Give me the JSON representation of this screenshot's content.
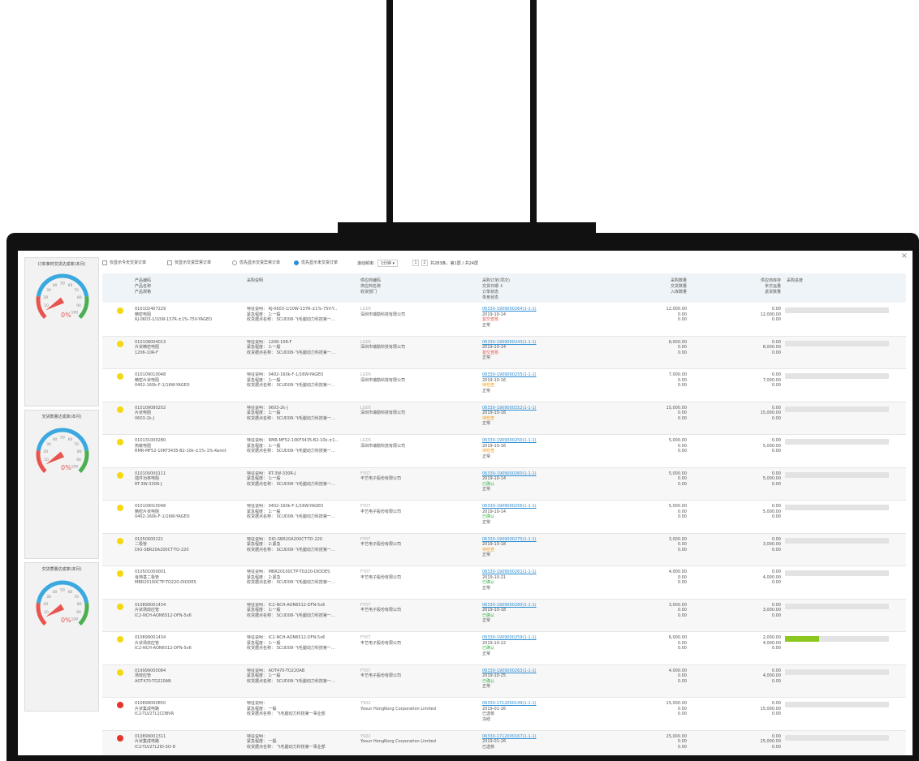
{
  "header": {
    "filters": {
      "only_today": "仅显示今天交货订单",
      "only_abnormal": "仅显示交货异常订单",
      "prio_abnormal": "优先显示交货异常订单",
      "prio_undelivered": "优先显示未交货订单"
    },
    "refresh_label": "滚动频率:",
    "refresh_value": "1分钟",
    "pager_pages": [
      "1",
      "2"
    ],
    "pager_info": "共283条，第1屏 / 共24屏"
  },
  "gauges": [
    {
      "title": "订单准时交货达成率(本月)",
      "value": 0,
      "value_text": "0%"
    },
    {
      "title": "交货数量达成率(本月)",
      "value": 0,
      "value_text": "0%"
    },
    {
      "title": "交货质量达成率(本月)",
      "value": 0,
      "value_text": "0%"
    }
  ],
  "gauge_ticks": [
    "10",
    "20",
    "30",
    "40",
    "50",
    "60",
    "70",
    "80",
    "90",
    "100"
  ],
  "columns": {
    "product": [
      "产品编码",
      "产品名称",
      "产品规格"
    ],
    "purchase": "采购说明",
    "supplier": [
      "供应商编码",
      "供应商名称",
      "收货部门"
    ],
    "order": [
      "采购订单(项次)",
      "交货日期 ⇕",
      "订单状态",
      "单身状态"
    ],
    "qty": [
      "采购数量",
      "交货数量",
      "入库数量"
    ],
    "stock": [
      "供应商库存",
      "未交运量",
      "退货数量"
    ],
    "progress": "采购进度"
  },
  "colors": {
    "yellow": "#f5d80f",
    "red": "#e8322c",
    "accent": "#2a8dd4",
    "progress": "#8bc71e"
  },
  "rows": [
    {
      "status": "yellow",
      "code": "010102407229",
      "name": "精密电阻",
      "spec": "RJ-0603-1/10W-137R-±1%-75V-YAGEO",
      "p1": "特征说明： RJ-0603-1/10W-137R-±1%-75V-Y...",
      "p2": "紧急程度： 1:一般",
      "p3": "收货据点名称： SCUD08-飞毛腿动力科技第一...",
      "sup_code": "LG05",
      "sup_name": "深圳市瑞勒科技有限公司",
      "dept": "",
      "order": "06330-1909000264(1-1-1)",
      "date": "2019-10-14",
      "ostatus": "首交查核",
      "ostatus_cls": "red",
      "lstatus": "正常",
      "qty1": "12,000.00",
      "qty2": "0.00",
      "qty3": "0.00",
      "s1": "0.00",
      "s2": "12,000.00",
      "s3": "0.00",
      "progress": 0
    },
    {
      "status": "yellow",
      "code": "010108004013",
      "name": "片状精密电阻",
      "spec": "1206-10R-F",
      "p1": "特征说明： 1206-10R-F",
      "p2": "紧急程度： 1:一般",
      "p3": "收货据点名称： SCUD08-飞毛腿动力科技第一...",
      "sup_code": "LG05",
      "sup_name": "深圳市瑞勒科技有限公司",
      "dept": "",
      "order": "06330-1909000243(1-1-1)",
      "date": "2019-10-14",
      "ostatus": "首交查核",
      "ostatus_cls": "red",
      "lstatus": "正常",
      "qty1": "8,000.00",
      "qty2": "0.00",
      "qty3": "0.00",
      "s1": "0.00",
      "s2": "8,000.00",
      "s3": "0.00",
      "progress": 0
    },
    {
      "status": "yellow",
      "code": "010109010048",
      "name": "精密片状电阻",
      "spec": "0402-160k-F-1/16W-YAGEO",
      "p1": "特征说明： 0402-160k-F-1/16W-YAGEO",
      "p2": "紧急程度： 1:一般",
      "p3": "收货据点名称： SCUD08-飞毛腿动力科技第一...",
      "sup_code": "LG05",
      "sup_name": "深圳市瑞勒科技有限公司",
      "dept": "",
      "order": "06330-1909000255(1-1-1)",
      "date": "2019-10-16",
      "ostatus": "待检查",
      "ostatus_cls": "orange",
      "lstatus": "正常",
      "qty1": "7,000.00",
      "qty2": "0.00",
      "qty3": "0.00",
      "s1": "0.00",
      "s2": "7,000.00",
      "s3": "0.00",
      "progress": 0
    },
    {
      "status": "yellow",
      "code": "010109080202",
      "name": "片状电阻",
      "spec": "0603-2k-J",
      "p1": "特征说明： 0603-2k-J",
      "p2": "紧急程度： 1:一般",
      "p3": "收货据点名称： SCUD08-飞毛腿动力科技第一...",
      "sup_code": "LG05",
      "sup_name": "深圳市瑞勒科技有限公司",
      "dept": "",
      "order": "06330-1909000252(1-1-1)",
      "date": "2019-10-16",
      "ostatus": "待检查",
      "ostatus_cls": "orange",
      "lstatus": "正常",
      "qty1": "15,000.00",
      "qty2": "0.00",
      "qty3": "0.00",
      "s1": "0.00",
      "s2": "15,000.00",
      "s3": "0.00",
      "progress": 0
    },
    {
      "status": "yellow",
      "code": "010131000280",
      "name": "热敏电阻",
      "spec": "RMR-MF52-10KF3435-B2-10k-±1%-1%-Kemit",
      "p1": "特征说明： RMR-MF52-10KF3435-B2-10k-±1...",
      "p2": "紧急程度： 1:一般",
      "p3": "收货据点名称： SCUD08-飞毛腿动力科技第一...",
      "sup_code": "LG05",
      "sup_name": "深圳市瑞勒科技有限公司",
      "dept": "",
      "order": "06330-1909000250(1-1-1)",
      "date": "2019-10-16",
      "ostatus": "待检查",
      "ostatus_cls": "orange",
      "lstatus": "正常",
      "qty1": "5,000.00",
      "qty2": "0.00",
      "qty3": "0.00",
      "s1": "0.00",
      "s2": "5,000.00",
      "s3": "0.00",
      "progress": 0
    },
    {
      "status": "yellow",
      "code": "010100000111",
      "name": "插件功率电阻",
      "spec": "RT-3W-330R-J",
      "p1": "特征说明： RT-3W-330R-J",
      "p2": "紧急程度： 1:一般",
      "p3": "收货据点名称： SCUD08-飞毛腿动力科技第一...",
      "sup_code": "FY07",
      "sup_name": "丰艺电子股份有限公司",
      "dept": "",
      "order": "06330-1909000260(1-1-1)",
      "date": "2019-10-14",
      "ostatus": "已确认",
      "ostatus_cls": "green",
      "lstatus": "正常",
      "qty1": "5,000.00",
      "qty2": "0.00",
      "qty3": "0.00",
      "s1": "0.00",
      "s2": "5,000.00",
      "s3": "0.00",
      "progress": 0
    },
    {
      "status": "yellow",
      "code": "010109010048",
      "name": "精密片状电阻",
      "spec": "0402-160k-F-1/16W-YAGEO",
      "p1": "特征说明： 0402-160k-F-1/16W-YAGEO",
      "p2": "紧急程度： 1:一般",
      "p3": "收货据点名称： SCUD08-飞毛腿动力科技第一...",
      "sup_code": "FY07",
      "sup_name": "丰艺电子股份有限公司",
      "dept": "",
      "order": "06330-1909000256(1-1-1)",
      "date": "2019-10-14",
      "ostatus": "已确认",
      "ostatus_cls": "green",
      "lstatus": "正常",
      "qty1": "5,000.00",
      "qty2": "0.00",
      "qty3": "0.00",
      "s1": "0.00",
      "s2": "5,000.00",
      "s3": "0.00",
      "progress": 0
    },
    {
      "status": "yellow",
      "code": "01050000121",
      "name": "二极管",
      "spec": "DIO-SBR20A200CT-TO-220",
      "p1": "特征说明： DIO-SBR20A200CT-TO-220",
      "p2": "紧急程度： 2:紧急",
      "p3": "收货据点名称： SCUD08-飞毛腿动力科技第一...",
      "sup_code": "FY07",
      "sup_name": "丰艺电子股份有限公司",
      "dept": "",
      "order": "06330-1909000270(1-1-1)",
      "date": "2019-10-18",
      "ostatus": "待检查",
      "ostatus_cls": "orange",
      "lstatus": "正常",
      "qty1": "3,000.00",
      "qty2": "0.00",
      "qty3": "0.00",
      "s1": "0.00",
      "s2": "3,000.00",
      "s3": "0.00",
      "progress": 0
    },
    {
      "status": "yellow",
      "code": "010501000001",
      "name": "肖特基二极管",
      "spec": "MBR20100CTP-TO220-DIODES",
      "p1": "特征说明： MBR20100CTP-TO220-DIODES",
      "p2": "紧急程度： 2:紧急",
      "p3": "收货据点名称： SCUD08-飞毛腿动力科技第一...",
      "sup_code": "FY07",
      "sup_name": "丰艺电子股份有限公司",
      "dept": "",
      "order": "06330-1909000261(1-1-1)",
      "date": "2019-10-21",
      "ostatus": "已确认",
      "ostatus_cls": "green",
      "lstatus": "正常",
      "qty1": "4,000.00",
      "qty2": "0.00",
      "qty3": "0.00",
      "s1": "0.00",
      "s2": "4,000.00",
      "s3": "0.00",
      "progress": 0
    },
    {
      "status": "yellow",
      "code": "010899001434",
      "name": "片状场效应管",
      "spec": "IC2-NCH-AON6512-DFN-5x6",
      "p1": "特征说明： IC2-NCH-AON6512-DFN-5x6",
      "p2": "紧急程度： 1:一般",
      "p3": "收货据点名称： SCUD08-飞毛腿动力科技第一...",
      "sup_code": "FY07",
      "sup_name": "丰艺电子股份有限公司",
      "dept": "",
      "order": "06330-1909000280(1-1-1)",
      "date": "2019-10-18",
      "ostatus": "已确认",
      "ostatus_cls": "green",
      "lstatus": "正常",
      "qty1": "3,000.00",
      "qty2": "0.00",
      "qty3": "0.00",
      "s1": "0.00",
      "s2": "3,000.00",
      "s3": "0.00",
      "progress": 0
    },
    {
      "status": "yellow",
      "code": "010899001434",
      "name": "片状场效应管",
      "spec": "IC2-NCH-AON6512-DFN-5x6",
      "p1": "特征说明： IC2-NCH-AON6512-DFN-5x6",
      "p2": "紧急程度： 1:一般",
      "p3": "收货据点名称： SCUD08-飞毛腿动力科技第一...",
      "sup_code": "FY07",
      "sup_name": "丰艺电子股份有限公司",
      "dept": "",
      "order": "06330-1909000259(1-1-1)",
      "date": "2019-10-22",
      "ostatus": "已确认",
      "ostatus_cls": "green",
      "lstatus": "正常",
      "qty1": "6,000.00",
      "qty2": "0.00",
      "qty3": "0.00",
      "s1": "2,000.00",
      "s2": "4,000.00",
      "s3": "0.00",
      "progress": 0.33
    },
    {
      "status": "yellow",
      "code": "019999000084",
      "name": "场效应管",
      "spec": "AOT470-TO220AB",
      "p1": "特征说明： AOT470-TO220AB",
      "p2": "紧急程度： 1:一般",
      "p3": "收货据点名称： SCUD08-飞毛腿动力科技第一...",
      "sup_code": "FY07",
      "sup_name": "丰艺电子股份有限公司",
      "dept": "",
      "order": "06330-1909000263(1-1-1)",
      "date": "2019-10-25",
      "ostatus": "已确认",
      "ostatus_cls": "green",
      "lstatus": "正常",
      "qty1": "4,000.00",
      "qty2": "0.00",
      "qty3": "0.00",
      "s1": "0.00",
      "s2": "4,000.00",
      "s3": "0.00",
      "progress": 0
    },
    {
      "status": "red",
      "code": "010899000850",
      "name": "片状集成电路",
      "spec": "IC2-TLV27L1CDBVR",
      "p1": "特征说明：",
      "p2": "紧急程度： 一般",
      "p3": "收货据点名称： 飞毛腿动力科技第一事业部",
      "sup_code": "YS02",
      "sup_name": "Yosun HongKong Corporation Limited",
      "dept": "",
      "order": "06330-1712000149(1-1-1)",
      "date": "2019-01-26",
      "ostatus": "已送核",
      "ostatus_cls": "",
      "lstatus": "冻结",
      "qty1": "15,000.00",
      "qty2": "0.00",
      "qty3": "0.00",
      "s1": "0.00",
      "s2": "15,000.00",
      "s3": "0.00",
      "progress": 0
    },
    {
      "status": "red",
      "code": "010899001311",
      "name": "片状集成电路",
      "spec": "IC2-TLV27L2ID-SO-8",
      "p1": "特征说明：",
      "p2": "紧急程度： 一般",
      "p3": "收货据点名称： 飞毛腿动力科技第一事业部",
      "sup_code": "YS02",
      "sup_name": "Yosun HongKong Corporation Limited",
      "dept": "",
      "order": "06330-1712000167(1-1-1)",
      "date": "2019-01-26",
      "ostatus": "已送核",
      "ostatus_cls": "",
      "lstatus": "",
      "qty1": "25,000.00",
      "qty2": "0.00",
      "qty3": "0.00",
      "s1": "0.00",
      "s2": "25,000.00",
      "s3": "0.00",
      "progress": 0
    }
  ]
}
